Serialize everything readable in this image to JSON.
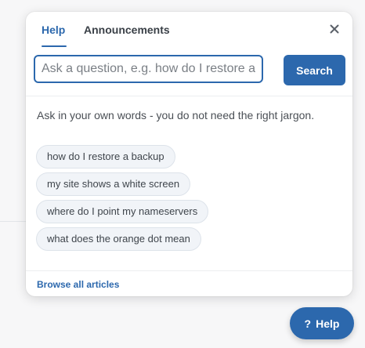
{
  "colors": {
    "accent": "#2c68ad",
    "chip_bg": "#f1f4f8",
    "page_bg": "#f7f7f8",
    "panel_bg": "#ffffff"
  },
  "help_panel": {
    "tabs": [
      {
        "label": "Help",
        "active": true
      },
      {
        "label": "Announcements",
        "active": false
      }
    ],
    "close_icon": "close-icon",
    "search": {
      "value": "",
      "placeholder": "Ask a question, e.g. how do I restore a backup",
      "button_label": "Search"
    },
    "hint_text": "Ask in your own words - you do not need the right jargon.",
    "suggestions": [
      "how do I restore a backup",
      "my site shows a white screen",
      "where do I point my nameservers",
      "what does the orange dot mean"
    ],
    "browse_link": "Browse all articles"
  },
  "help_fab": {
    "icon_text": "?",
    "label": "Help"
  }
}
